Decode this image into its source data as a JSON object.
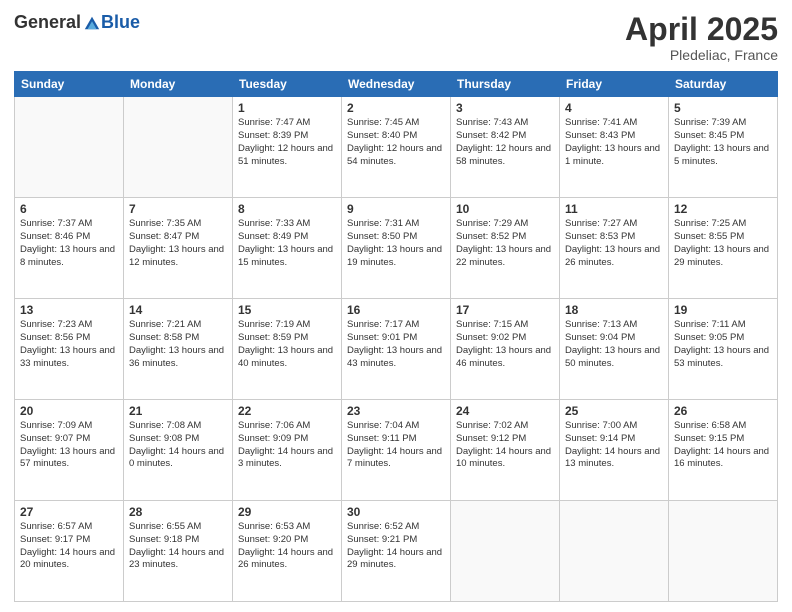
{
  "logo": {
    "general": "General",
    "blue": "Blue"
  },
  "title": "April 2025",
  "subtitle": "Pledeliac, France",
  "days": [
    "Sunday",
    "Monday",
    "Tuesday",
    "Wednesday",
    "Thursday",
    "Friday",
    "Saturday"
  ],
  "weeks": [
    [
      {
        "day": "",
        "info": ""
      },
      {
        "day": "",
        "info": ""
      },
      {
        "day": "1",
        "info": "Sunrise: 7:47 AM\nSunset: 8:39 PM\nDaylight: 12 hours and 51 minutes."
      },
      {
        "day": "2",
        "info": "Sunrise: 7:45 AM\nSunset: 8:40 PM\nDaylight: 12 hours and 54 minutes."
      },
      {
        "day": "3",
        "info": "Sunrise: 7:43 AM\nSunset: 8:42 PM\nDaylight: 12 hours and 58 minutes."
      },
      {
        "day": "4",
        "info": "Sunrise: 7:41 AM\nSunset: 8:43 PM\nDaylight: 13 hours and 1 minute."
      },
      {
        "day": "5",
        "info": "Sunrise: 7:39 AM\nSunset: 8:45 PM\nDaylight: 13 hours and 5 minutes."
      }
    ],
    [
      {
        "day": "6",
        "info": "Sunrise: 7:37 AM\nSunset: 8:46 PM\nDaylight: 13 hours and 8 minutes."
      },
      {
        "day": "7",
        "info": "Sunrise: 7:35 AM\nSunset: 8:47 PM\nDaylight: 13 hours and 12 minutes."
      },
      {
        "day": "8",
        "info": "Sunrise: 7:33 AM\nSunset: 8:49 PM\nDaylight: 13 hours and 15 minutes."
      },
      {
        "day": "9",
        "info": "Sunrise: 7:31 AM\nSunset: 8:50 PM\nDaylight: 13 hours and 19 minutes."
      },
      {
        "day": "10",
        "info": "Sunrise: 7:29 AM\nSunset: 8:52 PM\nDaylight: 13 hours and 22 minutes."
      },
      {
        "day": "11",
        "info": "Sunrise: 7:27 AM\nSunset: 8:53 PM\nDaylight: 13 hours and 26 minutes."
      },
      {
        "day": "12",
        "info": "Sunrise: 7:25 AM\nSunset: 8:55 PM\nDaylight: 13 hours and 29 minutes."
      }
    ],
    [
      {
        "day": "13",
        "info": "Sunrise: 7:23 AM\nSunset: 8:56 PM\nDaylight: 13 hours and 33 minutes."
      },
      {
        "day": "14",
        "info": "Sunrise: 7:21 AM\nSunset: 8:58 PM\nDaylight: 13 hours and 36 minutes."
      },
      {
        "day": "15",
        "info": "Sunrise: 7:19 AM\nSunset: 8:59 PM\nDaylight: 13 hours and 40 minutes."
      },
      {
        "day": "16",
        "info": "Sunrise: 7:17 AM\nSunset: 9:01 PM\nDaylight: 13 hours and 43 minutes."
      },
      {
        "day": "17",
        "info": "Sunrise: 7:15 AM\nSunset: 9:02 PM\nDaylight: 13 hours and 46 minutes."
      },
      {
        "day": "18",
        "info": "Sunrise: 7:13 AM\nSunset: 9:04 PM\nDaylight: 13 hours and 50 minutes."
      },
      {
        "day": "19",
        "info": "Sunrise: 7:11 AM\nSunset: 9:05 PM\nDaylight: 13 hours and 53 minutes."
      }
    ],
    [
      {
        "day": "20",
        "info": "Sunrise: 7:09 AM\nSunset: 9:07 PM\nDaylight: 13 hours and 57 minutes."
      },
      {
        "day": "21",
        "info": "Sunrise: 7:08 AM\nSunset: 9:08 PM\nDaylight: 14 hours and 0 minutes."
      },
      {
        "day": "22",
        "info": "Sunrise: 7:06 AM\nSunset: 9:09 PM\nDaylight: 14 hours and 3 minutes."
      },
      {
        "day": "23",
        "info": "Sunrise: 7:04 AM\nSunset: 9:11 PM\nDaylight: 14 hours and 7 minutes."
      },
      {
        "day": "24",
        "info": "Sunrise: 7:02 AM\nSunset: 9:12 PM\nDaylight: 14 hours and 10 minutes."
      },
      {
        "day": "25",
        "info": "Sunrise: 7:00 AM\nSunset: 9:14 PM\nDaylight: 14 hours and 13 minutes."
      },
      {
        "day": "26",
        "info": "Sunrise: 6:58 AM\nSunset: 9:15 PM\nDaylight: 14 hours and 16 minutes."
      }
    ],
    [
      {
        "day": "27",
        "info": "Sunrise: 6:57 AM\nSunset: 9:17 PM\nDaylight: 14 hours and 20 minutes."
      },
      {
        "day": "28",
        "info": "Sunrise: 6:55 AM\nSunset: 9:18 PM\nDaylight: 14 hours and 23 minutes."
      },
      {
        "day": "29",
        "info": "Sunrise: 6:53 AM\nSunset: 9:20 PM\nDaylight: 14 hours and 26 minutes."
      },
      {
        "day": "30",
        "info": "Sunrise: 6:52 AM\nSunset: 9:21 PM\nDaylight: 14 hours and 29 minutes."
      },
      {
        "day": "",
        "info": ""
      },
      {
        "day": "",
        "info": ""
      },
      {
        "day": "",
        "info": ""
      }
    ]
  ]
}
